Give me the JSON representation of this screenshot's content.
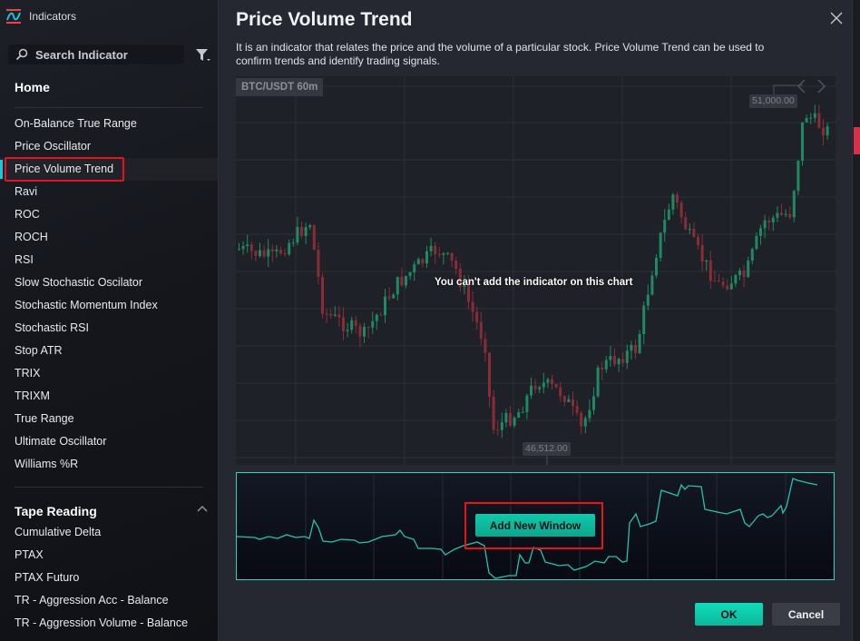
{
  "sidebar": {
    "app_title": "Indicators",
    "search_placeholder": "Search Indicator",
    "home_title": "Home",
    "home_items": [
      {
        "label": "On-Balance True Range"
      },
      {
        "label": "Price Oscillator"
      },
      {
        "label": "Price Volume Trend",
        "active": true
      },
      {
        "label": "Ravi"
      },
      {
        "label": "ROC"
      },
      {
        "label": "ROCH"
      },
      {
        "label": "RSI"
      },
      {
        "label": "Slow Stochastic Oscilator"
      },
      {
        "label": "Stochastic Momentum Index"
      },
      {
        "label": "Stochastic RSI"
      },
      {
        "label": "Stop ATR"
      },
      {
        "label": "TRIX"
      },
      {
        "label": "TRIXM"
      },
      {
        "label": "True Range"
      },
      {
        "label": "Ultimate Oscillator"
      },
      {
        "label": "Williams %R"
      }
    ],
    "tape_title": "Tape Reading",
    "tape_items": [
      {
        "label": "Cumulative Delta"
      },
      {
        "label": "PTAX"
      },
      {
        "label": "PTAX Futuro"
      },
      {
        "label": "TR - Aggression Acc - Balance"
      },
      {
        "label": "TR - Aggression Volume - Balance"
      }
    ]
  },
  "main": {
    "title": "Price Volume Trend",
    "description": "It is an indicator that relates the price and the volume of a particular stock. Price Volume Trend can be used to confirm trends and identify trading signals.",
    "chart": {
      "symbol": "BTC/USDT 60m",
      "high_label": "51,000.00",
      "low_label": "46,512.00",
      "overlay_message": "You can't add the indicator on this chart"
    },
    "add_window_label": "Add New Window",
    "ok_label": "OK",
    "cancel_label": "Cancel"
  },
  "colors": {
    "accent": "#12c8aa",
    "up_candle": "#1f8a62",
    "down_candle": "#8a2c38",
    "highlight": "#e8121a"
  }
}
